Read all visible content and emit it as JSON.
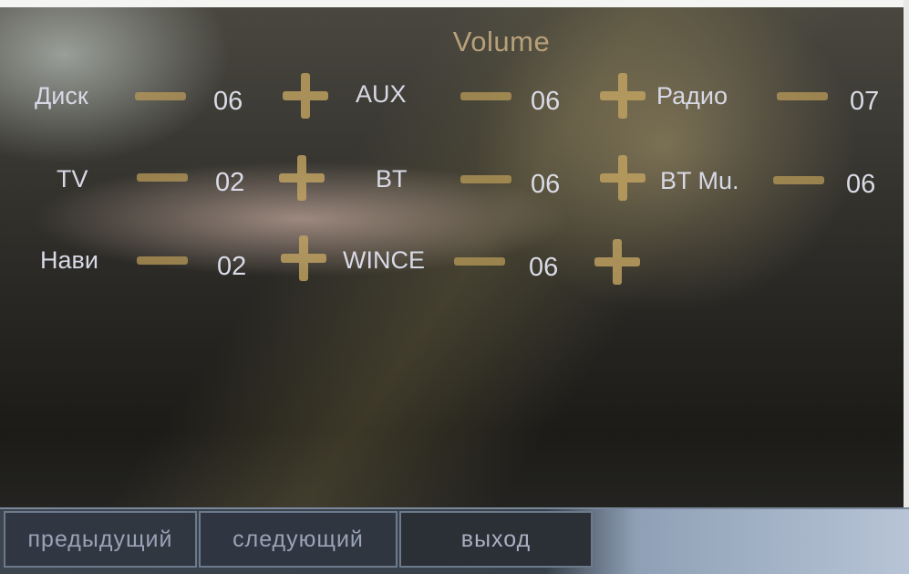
{
  "title": "Volume",
  "colors": {
    "accent": "#c4a562",
    "text": "#d9dbe6",
    "title": "#b8a07a"
  },
  "channels": [
    {
      "label": "Диск",
      "value": "06"
    },
    {
      "label": "AUX",
      "value": "06"
    },
    {
      "label": "Радио",
      "value": "07"
    },
    {
      "label": "TV",
      "value": "02"
    },
    {
      "label": "BT",
      "value": "06"
    },
    {
      "label": "BT Mu.",
      "value": "06"
    },
    {
      "label": "Нави",
      "value": "02"
    },
    {
      "label": "WINCE",
      "value": "06"
    }
  ],
  "buttons": {
    "prev": "предыдущий",
    "next": "следующий",
    "exit": "выход"
  },
  "icons": {
    "decrease": "minus-icon",
    "increase": "plus-icon"
  }
}
